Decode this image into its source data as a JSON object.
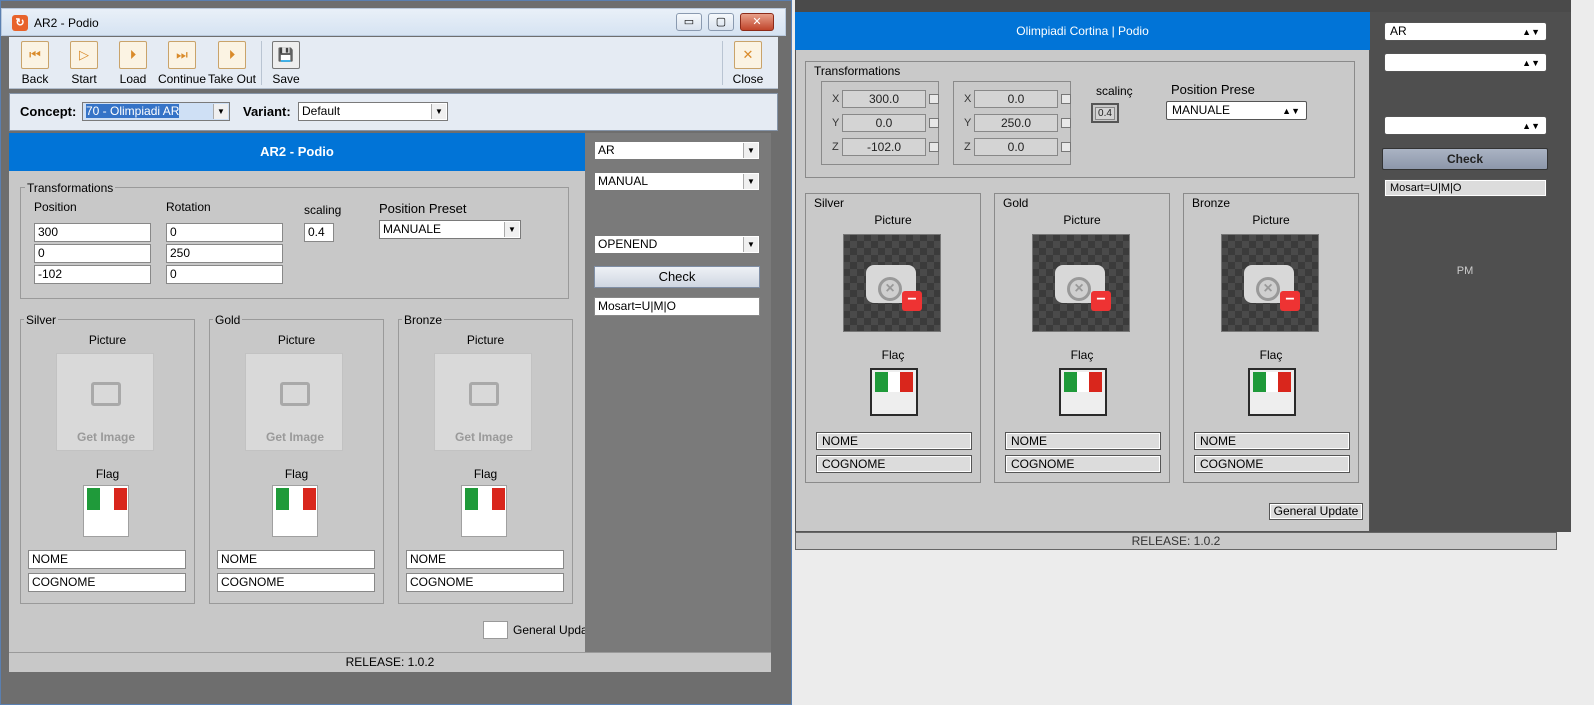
{
  "left": {
    "title": "AR2 - Podio",
    "window_buttons": {
      "minimize": "▭",
      "maximize": "▢",
      "close": "✕"
    },
    "toolbar": [
      {
        "label": "Back",
        "icon": "back-icon",
        "glyph": "⏮"
      },
      {
        "label": "Start",
        "icon": "play-icon",
        "glyph": "▷"
      },
      {
        "label": "Load",
        "icon": "load-icon",
        "glyph": "⏵"
      },
      {
        "label": "Continue",
        "icon": "continue-icon",
        "glyph": "⏭"
      },
      {
        "label": "Take Out",
        "icon": "takeout-icon",
        "glyph": "⏵"
      },
      {
        "label": "Save",
        "icon": "save-icon",
        "glyph": "💾"
      },
      {
        "label": "Close",
        "icon": "close-icon",
        "glyph": "✕"
      }
    ],
    "concept_label": "Concept:",
    "concept_value": "70 - Olimpiadi AR",
    "variant_label": "Variant:",
    "variant_value": "Default",
    "header": "AR2 - Podio",
    "transformations_label": "Transformations",
    "position_label": "Position",
    "rotation_label": "Rotation",
    "scaling_label": "scaling",
    "scaling_value": "0.4",
    "position": [
      "300",
      "0",
      "-102"
    ],
    "rotation": [
      "0",
      "250",
      "0"
    ],
    "preset_label": "Position Preset",
    "preset_value": "MANUALE",
    "medals": [
      {
        "name": "Silver",
        "picture": "Picture",
        "get_image": "Get Image",
        "flag": "Flag",
        "nome": "NOME",
        "cognome": "COGNOME"
      },
      {
        "name": "Gold",
        "picture": "Picture",
        "get_image": "Get Image",
        "flag": "Flag",
        "nome": "NOME",
        "cognome": "COGNOME"
      },
      {
        "name": "Bronze",
        "picture": "Picture",
        "get_image": "Get Image",
        "flag": "Flag",
        "nome": "NOME",
        "cognome": "COGNOME"
      }
    ],
    "general_update": "General Upda",
    "side": {
      "combo1": "AR",
      "combo2": "MANUAL",
      "combo3": "OPENEND",
      "check": "Check",
      "mosart": "Mosart=U|M|O"
    },
    "release": "RELEASE: 1.0.2"
  },
  "right": {
    "header": "Olimpiadi Cortina | Podio",
    "transformations_label": "Transformations",
    "axes": [
      "X",
      "Y",
      "Z"
    ],
    "position": [
      "300.0",
      "0.0",
      "-102.0"
    ],
    "rotation": [
      "0.0",
      "250.0",
      "0.0"
    ],
    "scaling_label": "scalinç",
    "scaling_value": "0.4",
    "preset_label": "Position Prese",
    "preset_value": "MANUALE",
    "medals": [
      {
        "name": "Silver",
        "picture": "Picture",
        "flag": "Flaç",
        "nome": "NOME",
        "cognome": "COGNOME"
      },
      {
        "name": "Gold",
        "picture": "Picture",
        "flag": "Flaç",
        "nome": "NOME",
        "cognome": "COGNOME"
      },
      {
        "name": "Bronze",
        "picture": "Picture",
        "flag": "Flaç",
        "nome": "NOME",
        "cognome": "COGNOME"
      }
    ],
    "general_update": "General Update",
    "side": {
      "combo1": "AR",
      "combo2": "",
      "combo3": "",
      "check": "Check",
      "mosart": "Mosart=U|M|O",
      "pm": "PM"
    },
    "release": "RELEASE: 1.0.2"
  },
  "colors": {
    "accent": "#0174d7",
    "flag_green": "#1f9a3a",
    "flag_white": "#ffffff",
    "flag_red": "#d9261c"
  }
}
